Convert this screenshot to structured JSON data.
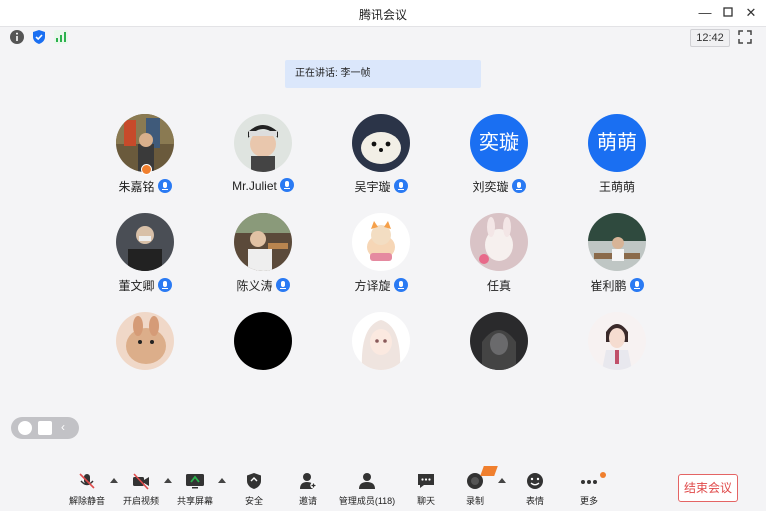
{
  "window": {
    "title": "腾讯会议",
    "clock": "12:42"
  },
  "speaking": "正在讲话: 李一帧",
  "participants": [
    {
      "name": "朱嘉铭",
      "avatar_text": "",
      "host": true
    },
    {
      "name": "Mr.Juliet",
      "avatar_text": ""
    },
    {
      "name": "吴宇璇",
      "avatar_text": ""
    },
    {
      "name": "刘奕璇",
      "avatar_text": "奕璇"
    },
    {
      "name": "王萌萌",
      "avatar_text": "萌萌"
    },
    {
      "name": "董文卿",
      "avatar_text": ""
    },
    {
      "name": "陈义涛",
      "avatar_text": ""
    },
    {
      "name": "方译旋",
      "avatar_text": ""
    },
    {
      "name": "任真",
      "avatar_text": ""
    },
    {
      "name": "崔利鹏",
      "avatar_text": ""
    },
    {
      "name": "",
      "avatar_text": ""
    },
    {
      "name": "",
      "avatar_text": ""
    },
    {
      "name": "",
      "avatar_text": ""
    },
    {
      "name": "",
      "avatar_text": ""
    },
    {
      "name": "",
      "avatar_text": ""
    }
  ],
  "bottom_bar": {
    "unmute": "解除静音",
    "video": "开启视频",
    "share": "共享屏幕",
    "security": "安全",
    "invite": "邀请",
    "members": "管理成员(118)",
    "chat": "聊天",
    "record": "录制",
    "emoji": "表情",
    "more": "更多",
    "end": "结束会议"
  },
  "colors": {
    "accent": "#1a6ff2",
    "end": "#e04a4a",
    "speaking_bg": "#dbe7fb"
  }
}
